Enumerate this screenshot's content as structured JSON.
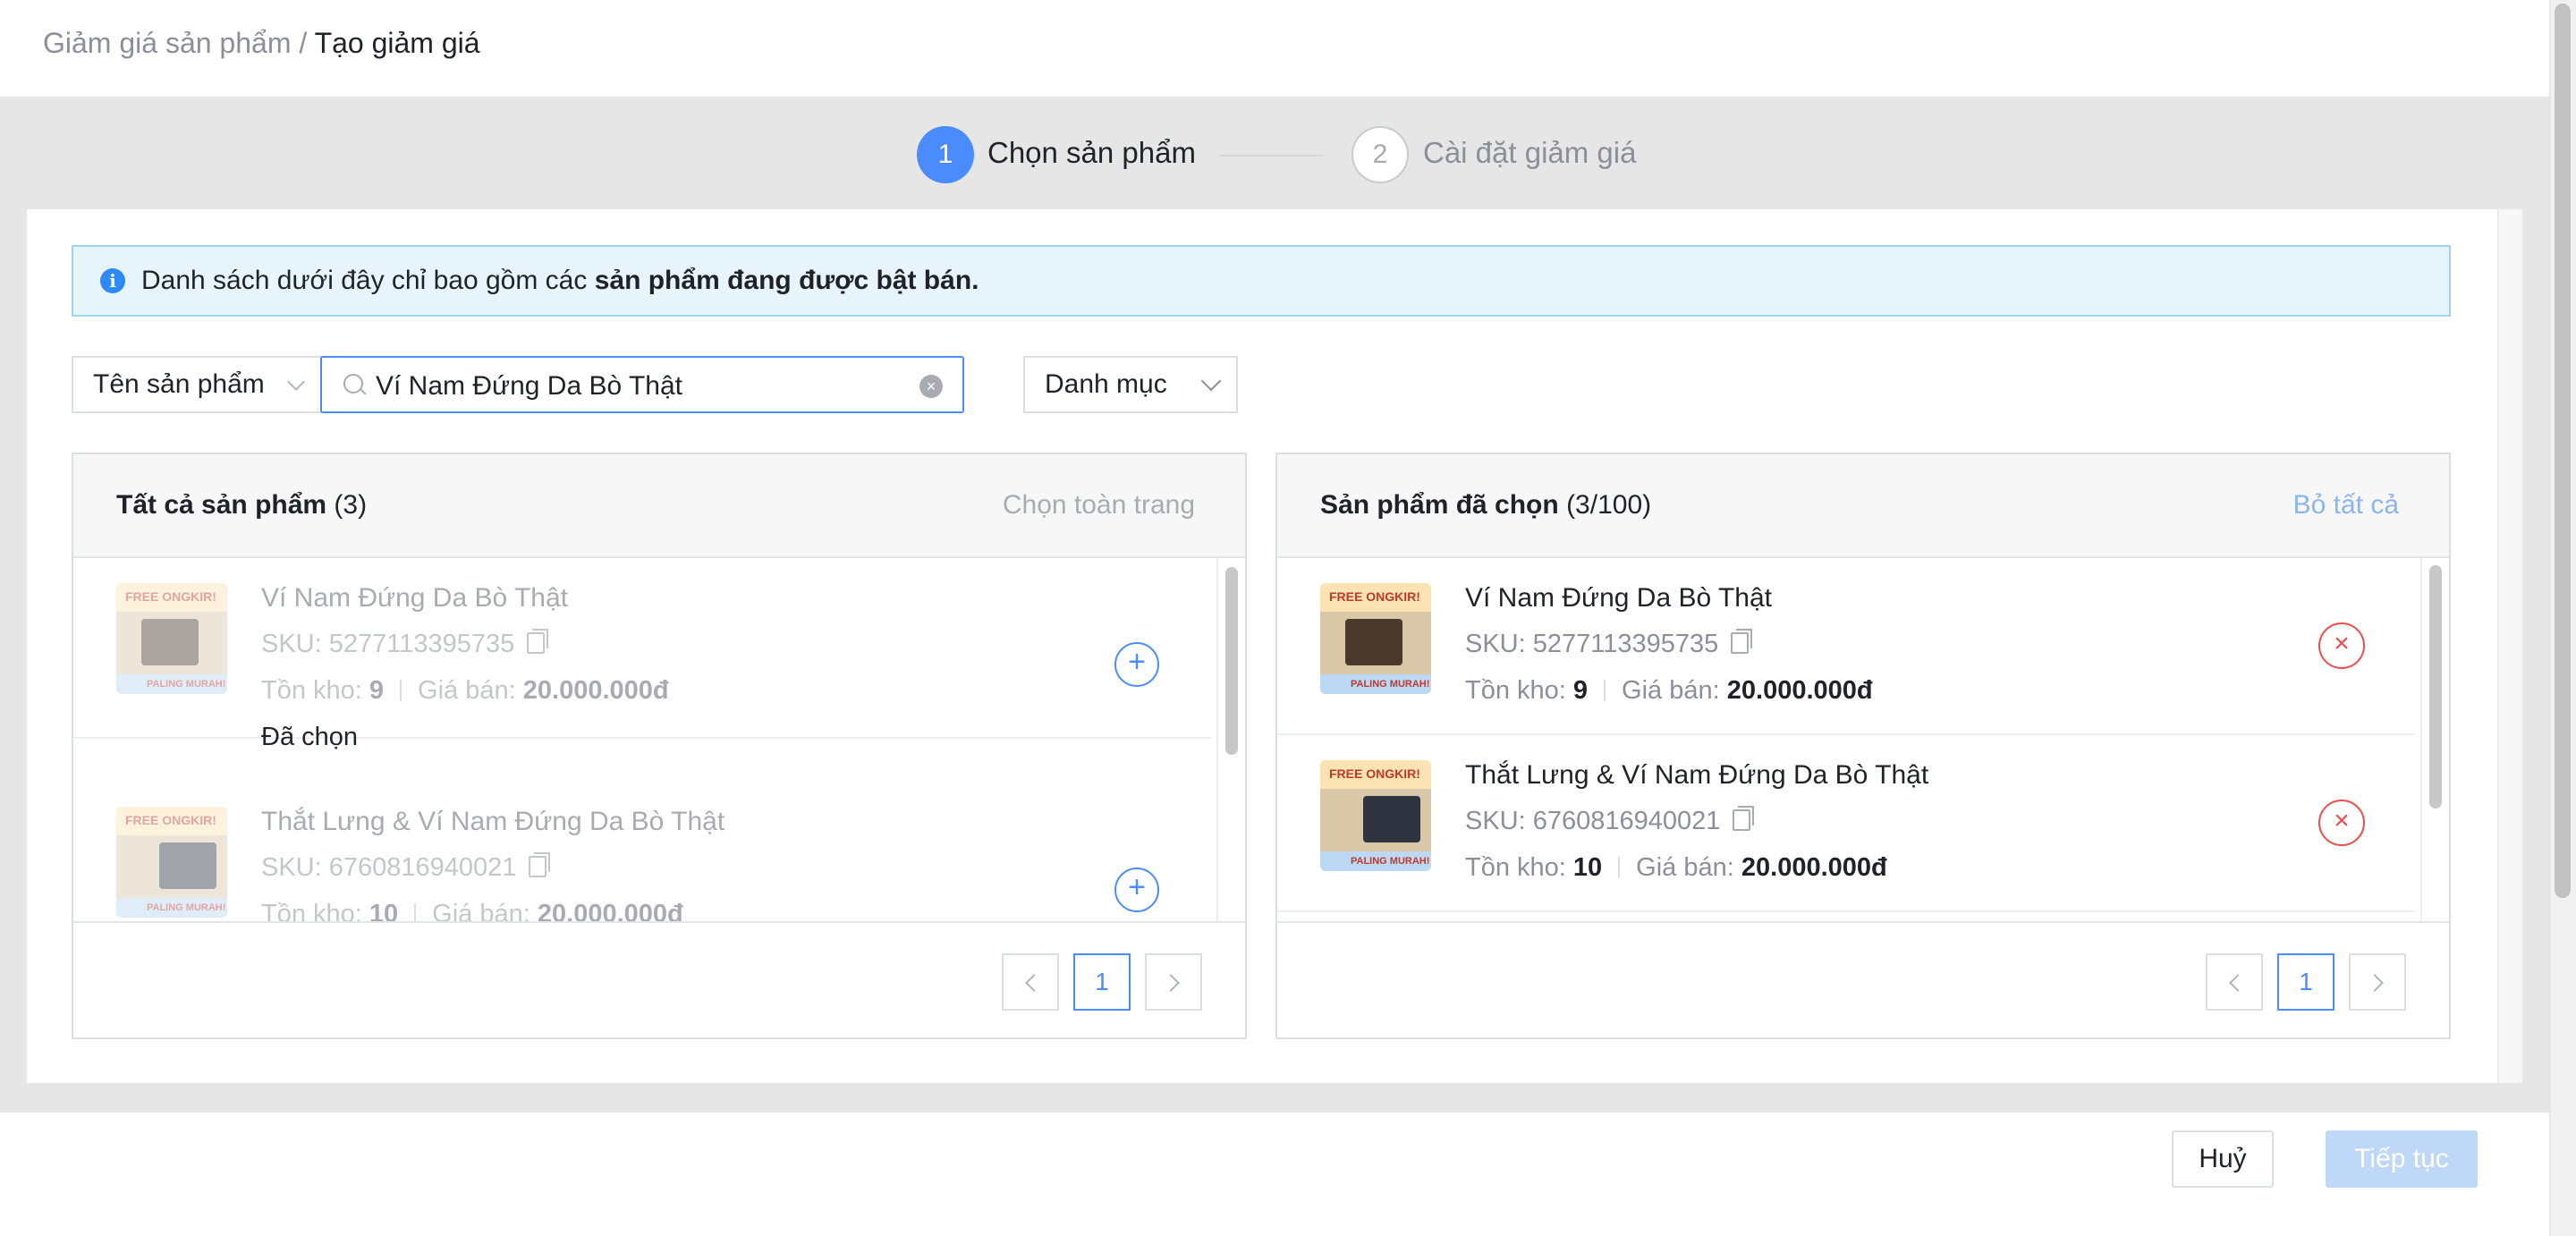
{
  "breadcrumb": {
    "parent": "Giảm giá sản phẩm",
    "separator": " / ",
    "current": "Tạo giảm giá"
  },
  "steps": [
    {
      "number": "1",
      "label": "Chọn sản phẩm",
      "state": "active"
    },
    {
      "number": "2",
      "label": "Cài đặt giảm giá",
      "state": "inactive"
    }
  ],
  "banner": {
    "text": "Danh sách dưới đây chỉ bao gồm các ",
    "bold": "sản phẩm đang được bật bán."
  },
  "filters": {
    "field_select": "Tên sản phẩm",
    "search_value": "Ví Nam Đứng Da Bò Thật",
    "category_select": "Danh mục"
  },
  "left_panel": {
    "title": "Tất cả sản phẩm",
    "count": "(3)",
    "action": "Chọn toàn trang",
    "items": [
      {
        "name": "Ví Nam Đứng Da Bò Thật",
        "sku": "SKU: 5277113395735",
        "stock_label": "Tồn kho:",
        "stock": "9",
        "price_label": "Giá bán:",
        "price": "20.000.000đ",
        "status": "Đã chọn"
      },
      {
        "name": "Thắt Lưng & Ví Nam Đứng Da Bò Thật",
        "sku": "SKU: 6760816940021",
        "stock_label": "Tồn kho:",
        "stock": "10",
        "price_label": "Giá bán:",
        "price": "20.000.000đ"
      }
    ],
    "page": "1"
  },
  "right_panel": {
    "title": "Sản phẩm đã chọn",
    "count": "(3/100)",
    "action": "Bỏ tất cả",
    "items": [
      {
        "name": "Ví Nam Đứng Da Bò Thật",
        "sku": "SKU: 5277113395735",
        "stock_label": "Tồn kho:",
        "stock": "9",
        "price_label": "Giá bán:",
        "price": "20.000.000đ"
      },
      {
        "name": "Thắt Lưng & Ví Nam Đứng Da Bò Thật",
        "sku": "SKU: 6760816940021",
        "stock_label": "Tồn kho:",
        "stock": "10",
        "price_label": "Giá bán:",
        "price": "20.000.000đ"
      }
    ],
    "page": "1"
  },
  "thumbnail": {
    "top_text": "FREE ONGKIR!",
    "band_text": "PALING MURAH!"
  },
  "footer": {
    "cancel": "Huỷ",
    "next": "Tiếp tục"
  },
  "colors": {
    "accent": "#4a8cff",
    "danger": "#ee4d4d",
    "banner_bg": "#e8f4fb"
  }
}
